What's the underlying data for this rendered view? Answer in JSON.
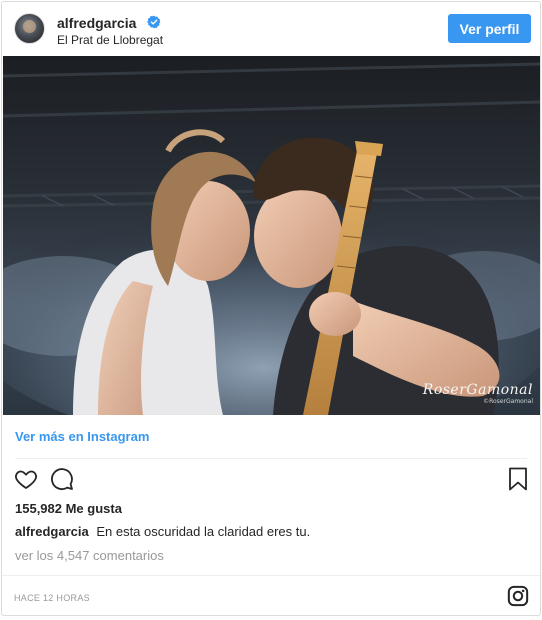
{
  "header": {
    "username": "alfredgarcia",
    "location": "El Prat de Llobregat",
    "profile_button": "Ver perfil"
  },
  "photo": {
    "watermark_main": "RoserGamonal",
    "watermark_sub": "©RoserGamonal"
  },
  "link": {
    "label": "Ver más en Instagram"
  },
  "stats": {
    "likes": "155,982 Me gusta"
  },
  "caption": {
    "user": "alfredgarcia",
    "text": "En esta oscuridad la claridad eres tu."
  },
  "comments": {
    "label": "ver los 4,547 comentarios"
  },
  "footer": {
    "timestamp": "HACE 12 HORAS"
  },
  "colors": {
    "accent": "#3897f0",
    "muted": "#999999",
    "text": "#262626"
  },
  "icons": {
    "verified": "verified-badge-icon",
    "like": "heart-icon",
    "comment": "comment-icon",
    "save": "bookmark-icon",
    "brand": "instagram-icon"
  }
}
